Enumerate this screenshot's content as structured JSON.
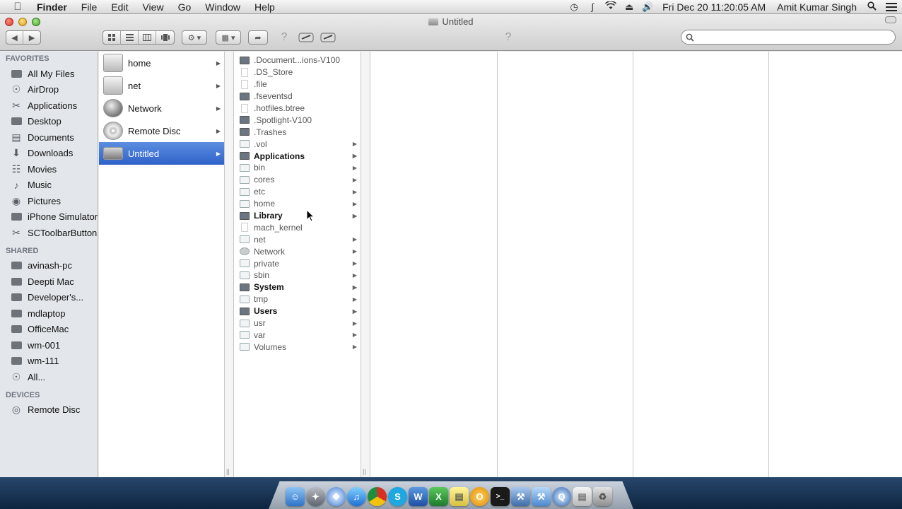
{
  "menubar": {
    "app_name": "Finder",
    "menus": [
      "File",
      "Edit",
      "View",
      "Go",
      "Window",
      "Help"
    ],
    "clock": "Fri Dec 20  11:20:05 AM",
    "user": "Amit Kumar Singh"
  },
  "window": {
    "title": "Untitled",
    "search_placeholder": ""
  },
  "sidebar": {
    "favorites_header": "FAVORITES",
    "favorites": [
      "All My Files",
      "AirDrop",
      "Applications",
      "Desktop",
      "Documents",
      "Downloads",
      "Movies",
      "Music",
      "Pictures",
      "iPhone Simulator",
      "SCToolbarButton"
    ],
    "shared_header": "SHARED",
    "shared": [
      "avinash-pc",
      "Deepti Mac",
      "Developer's...",
      "mdlaptop",
      "OfficeMac",
      "wm-001",
      "wm-111",
      "All..."
    ],
    "devices_header": "DEVICES",
    "devices": [
      "Remote Disc"
    ]
  },
  "column1": {
    "items": [
      "home",
      "net",
      "Network",
      "Remote Disc",
      "Untitled"
    ],
    "selected": "Untitled"
  },
  "column2": {
    "items": [
      ".Document...ions-V100",
      ".DS_Store",
      ".file",
      ".fseventsd",
      ".hotfiles.btree",
      ".Spotlight-V100",
      ".Trashes",
      ".vol",
      "Applications",
      "bin",
      "cores",
      "etc",
      "home",
      "Library",
      "mach_kernel",
      "net",
      "Network",
      "private",
      "sbin",
      "System",
      "tmp",
      "Users",
      "usr",
      "var",
      "Volumes"
    ]
  },
  "dock": {
    "icons": [
      "finder",
      "launchpad",
      "safari",
      "itunes",
      "chrome",
      "skype",
      "word",
      "excel",
      "stickies",
      "outlook",
      "terminal",
      "xcode",
      "instruments",
      "quicktime",
      "preview",
      "trash"
    ]
  },
  "colors": {
    "selection": "#3a6fd4",
    "sidebar_bg": "#e3e6ea"
  }
}
